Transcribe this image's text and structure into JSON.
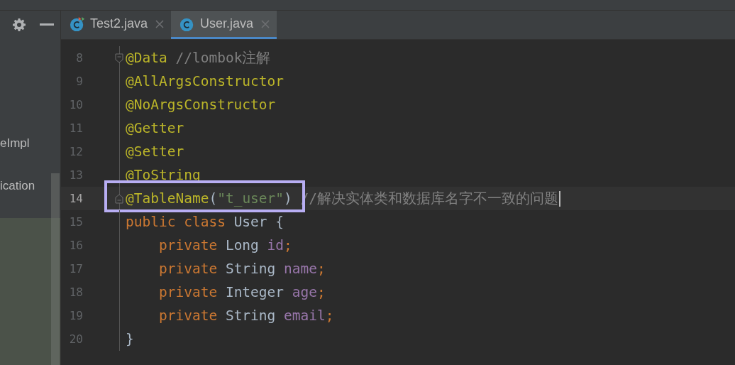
{
  "project_panel": {
    "items": [
      {
        "label": "eImpl",
        "selected": false
      },
      {
        "label": "ication",
        "selected": false
      },
      {
        "selected": true
      }
    ]
  },
  "toolbar": {
    "buttons": [
      {
        "kind": "settings"
      },
      {
        "kind": "minimize"
      }
    ]
  },
  "tabs": [
    {
      "label": "Test2.java",
      "selected": false,
      "runnable": true,
      "closable": true
    },
    {
      "label": "User.java",
      "selected": true,
      "runnable": false,
      "closable": true
    }
  ],
  "editor": {
    "lines": [
      {
        "number": "8",
        "kind": "fold_start",
        "current": false,
        "tokens": [
          {
            "kind": "annotation",
            "text": "@Data "
          },
          {
            "kind": "comment",
            "text": "//lombok注解"
          }
        ]
      },
      {
        "number": "9",
        "kind": "code",
        "current": false,
        "tokens": [
          {
            "kind": "annotation",
            "text": "@AllArgsConstructor"
          }
        ]
      },
      {
        "number": "10",
        "kind": "code",
        "current": false,
        "tokens": [
          {
            "kind": "annotation",
            "text": "@NoArgsConstructor"
          }
        ]
      },
      {
        "number": "11",
        "kind": "code",
        "current": false,
        "tokens": [
          {
            "kind": "annotation",
            "text": "@Getter"
          }
        ]
      },
      {
        "number": "12",
        "kind": "code",
        "current": false,
        "tokens": [
          {
            "kind": "annotation",
            "text": "@Setter"
          }
        ]
      },
      {
        "number": "13",
        "kind": "code",
        "current": false,
        "tokens": [
          {
            "kind": "annotation",
            "text": "@ToString"
          }
        ]
      },
      {
        "number": "14",
        "kind": "fold_end",
        "current": true,
        "boxed": true,
        "tokens": [
          {
            "kind": "annotation",
            "text": "@TableName"
          },
          {
            "kind": "plain",
            "text": "("
          },
          {
            "kind": "string",
            "text": "\"t_user\""
          },
          {
            "kind": "plain",
            "text": ") "
          },
          {
            "kind": "comment",
            "text": "//解决实体类和数据库名字不一致的问题"
          }
        ]
      },
      {
        "number": "15",
        "kind": "code",
        "current": false,
        "tokens": [
          {
            "kind": "keyword",
            "text": "public class "
          },
          {
            "kind": "plain",
            "text": "User {"
          }
        ]
      },
      {
        "number": "16",
        "kind": "code",
        "current": false,
        "tokens": [
          {
            "kind": "keyword",
            "text": "    private "
          },
          {
            "kind": "plain",
            "text": "Long "
          },
          {
            "kind": "field",
            "text": "id"
          },
          {
            "kind": "keyword",
            "text": ";"
          }
        ]
      },
      {
        "number": "17",
        "kind": "code",
        "current": false,
        "tokens": [
          {
            "kind": "keyword",
            "text": "    private "
          },
          {
            "kind": "plain",
            "text": "String "
          },
          {
            "kind": "field",
            "text": "name"
          },
          {
            "kind": "keyword",
            "text": ";"
          }
        ]
      },
      {
        "number": "18",
        "kind": "code",
        "current": false,
        "tokens": [
          {
            "kind": "keyword",
            "text": "    private "
          },
          {
            "kind": "plain",
            "text": "Integer "
          },
          {
            "kind": "field",
            "text": "age"
          },
          {
            "kind": "keyword",
            "text": ";"
          }
        ]
      },
      {
        "number": "19",
        "kind": "code",
        "current": false,
        "tokens": [
          {
            "kind": "keyword",
            "text": "    private "
          },
          {
            "kind": "plain",
            "text": "String "
          },
          {
            "kind": "field",
            "text": "email"
          },
          {
            "kind": "keyword",
            "text": ";"
          }
        ]
      },
      {
        "number": "20",
        "kind": "code",
        "current": false,
        "tokens": [
          {
            "kind": "plain",
            "text": "}"
          }
        ]
      }
    ]
  }
}
